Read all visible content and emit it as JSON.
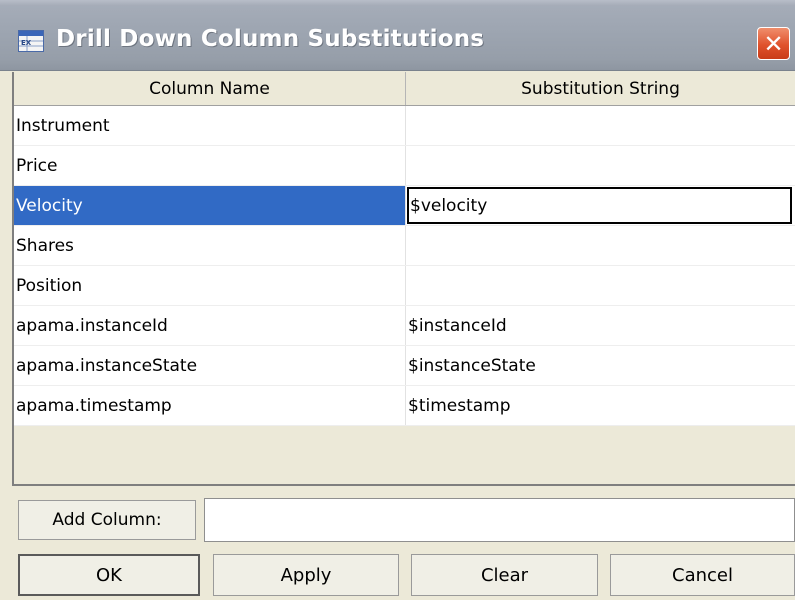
{
  "window": {
    "title": "Drill Down Column Substitutions",
    "close_glyph": "✕",
    "app_icon": "table-app-icon",
    "close_icon": "close-icon"
  },
  "table": {
    "headers": {
      "column_name": "Column Name",
      "substitution_string": "Substitution String"
    },
    "rows": [
      {
        "column_name": "Instrument",
        "substitution": ""
      },
      {
        "column_name": "Price",
        "substitution": ""
      },
      {
        "column_name": "Velocity",
        "substitution": "$velocity"
      },
      {
        "column_name": "Shares",
        "substitution": ""
      },
      {
        "column_name": "Position",
        "substitution": ""
      },
      {
        "column_name": "apama.instanceId",
        "substitution": "$instanceId"
      },
      {
        "column_name": "apama.instanceState",
        "substitution": "$instanceState"
      },
      {
        "column_name": "apama.timestamp",
        "substitution": "$timestamp"
      }
    ],
    "selected_row_index": 2,
    "selection_color": "#316ac5"
  },
  "add_column": {
    "button_label": "Add Column:",
    "input_value": "",
    "input_placeholder": ""
  },
  "buttons": {
    "ok": "OK",
    "apply": "Apply",
    "clear": "Clear",
    "cancel": "Cancel"
  }
}
